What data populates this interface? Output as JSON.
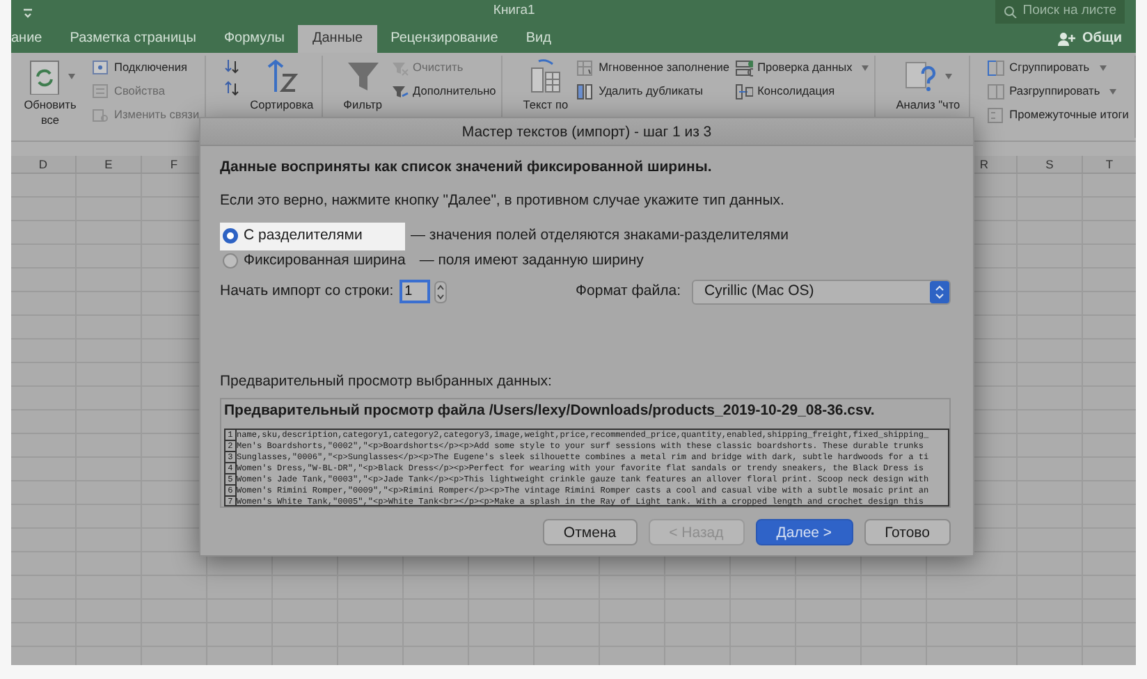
{
  "window": {
    "title": "Книга1",
    "search_placeholder": "Поиск на листе",
    "share_label": "Общи"
  },
  "tabs": [
    {
      "label": "ание",
      "selected": false
    },
    {
      "label": "Разметка страницы",
      "selected": false
    },
    {
      "label": "Формулы",
      "selected": false
    },
    {
      "label": "Данные",
      "selected": true
    },
    {
      "label": "Рецензирование",
      "selected": false
    },
    {
      "label": "Вид",
      "selected": false
    }
  ],
  "ribbon": {
    "groups": [
      {
        "columns": [
          {
            "kind": "large",
            "label": "Обновить все",
            "dropdown": true
          },
          {
            "kind": "stack",
            "items": [
              {
                "label": "Подключения",
                "disabled": false
              },
              {
                "label": "Свойства",
                "disabled": true
              },
              {
                "label": "Изменить связи",
                "disabled": true
              }
            ]
          }
        ]
      },
      {
        "columns": [
          {
            "kind": "stack",
            "items": [
              {
                "disabled": false
              },
              {
                "disabled": false
              }
            ]
          },
          {
            "kind": "large",
            "label": "Сортировка"
          }
        ]
      },
      {
        "columns": [
          {
            "kind": "large",
            "label": "Фильтр"
          },
          {
            "kind": "stack",
            "items": [
              {
                "label": "Очистить",
                "disabled": true
              },
              {
                "label": "Дополнительно",
                "disabled": false
              }
            ]
          }
        ]
      },
      {
        "columns": [
          {
            "kind": "large",
            "label": "Текст по"
          },
          {
            "kind": "stack",
            "items": [
              {
                "label": "Мгновенное заполнение",
                "disabled": false
              },
              {
                "label": "Удалить дубликаты",
                "disabled": false
              }
            ]
          },
          {
            "kind": "stack",
            "items": [
              {
                "label": "Проверка данных",
                "disabled": false,
                "dropdown": true
              },
              {
                "label": "Консолидация",
                "disabled": false
              }
            ]
          }
        ]
      },
      {
        "columns": [
          {
            "kind": "large",
            "label": "Анализ \"что",
            "dropdown": true
          }
        ]
      },
      {
        "columns": [
          {
            "kind": "stack",
            "items": [
              {
                "label": "Сгруппировать",
                "disabled": false,
                "dropdown": true
              },
              {
                "label": "Разгруппировать",
                "disabled": false,
                "dropdown": true
              },
              {
                "label": "Промежуточные итоги",
                "disabled": false
              }
            ]
          }
        ]
      }
    ]
  },
  "sheet": {
    "columns_left": [
      "D",
      "E",
      "F"
    ],
    "columns_right": [
      "R",
      "S",
      "T"
    ]
  },
  "dialog": {
    "title": "Мастер текстов (импорт) - шаг 1 из 3",
    "heading": "Данные восприняты как список значений фиксированной ширины.",
    "instruction": "Если это верно, нажмите кнопку \"Далее\", в противном случае укажите тип данных.",
    "options": [
      {
        "label": "С разделителями",
        "description": "— значения полей отделяются знаками-разделителями",
        "selected": true
      },
      {
        "label": "Фиксированная ширина",
        "description": "— поля имеют заданную ширину",
        "selected": false
      }
    ],
    "start_row": {
      "label": "Начать импорт со строки:",
      "value": "1",
      "focused": true
    },
    "file_format": {
      "label": "Формат файла:",
      "value": "Cyrillic (Mac OS)"
    },
    "preview_label": "Предварительный просмотр выбранных данных:",
    "preview_title": "Предварительный просмотр файла /Users/lexy/Downloads/products_2019-10-29_08-36.csv.",
    "preview_lines": [
      {
        "number": "1",
        "text": "name,sku,description,category1,category2,category3,image,weight,price,recommended_price,quantity,enabled,shipping_freight,fixed_shipping_"
      },
      {
        "number": "2",
        "text": "Men's Boardshorts,\"0002\",\"<p>Boardshorts</p><p>Add some style to your surf sessions with these classic boardshorts. These durable trunks"
      },
      {
        "number": "3",
        "text": "Sunglasses,\"0006\",\"<p>Sunglasses</p><p>The Eugene's sleek silhouette combines a metal rim and bridge with dark, subtle hardwoods for a ti"
      },
      {
        "number": "4",
        "text": "Women's Dress,\"W-BL-DR\",\"<p>Black Dress</p><p>Perfect for wearing with your favorite flat sandals or trendy sneakers, the Black Dress is"
      },
      {
        "number": "5",
        "text": "Women's Jade Tank,\"0003\",\"<p>Jade Tank</p><p>This lightweight crinkle gauze tank features an allover floral print. Scoop neck design with"
      },
      {
        "number": "6",
        "text": "Women's Rimini Romper,\"0009\",\"<p>Rimini Romper</p><p>The vintage Rimini Romper casts a cool and casual vibe with a subtle mosaic print an"
      },
      {
        "number": "7",
        "text": "Women's White Tank,\"0005\",\"<p>White Tank<br></p><p>Make a splash in the Ray of Light tank. With a cropped length and crochet design this"
      }
    ],
    "buttons": [
      {
        "label": "Отмена",
        "disabled": false,
        "default": false
      },
      {
        "label": "< Назад",
        "disabled": true,
        "default": false
      },
      {
        "label": "Далее >",
        "disabled": false,
        "default": true
      },
      {
        "label": "Готово",
        "disabled": false,
        "default": false
      }
    ]
  }
}
